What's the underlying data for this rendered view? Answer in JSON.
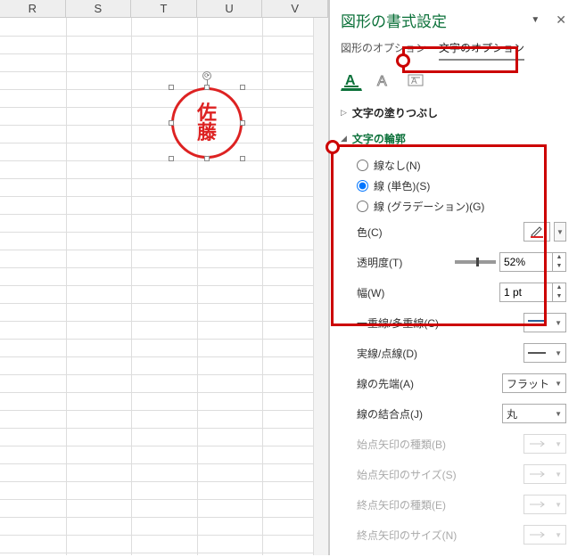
{
  "columns": [
    "R",
    "S",
    "T",
    "U",
    "V"
  ],
  "hanko_text_top": "佐",
  "hanko_text_bottom": "藤",
  "pane_title": "図形の書式設定",
  "tab_shape": "図形のオプション",
  "tab_text": "文字のオプション",
  "sec_fill": "文字の塗りつぶし",
  "sec_outline": "文字の輪郭",
  "radio_none": "線なし(N)",
  "radio_solid": "線 (単色)(S)",
  "radio_grad": "線 (グラデーション)(G)",
  "lab_color": "色(C)",
  "lab_trans": "透明度(T)",
  "val_trans": "52%",
  "lab_width": "幅(W)",
  "val_width": "1 pt",
  "lab_compound": "一重線/多重線(C)",
  "lab_dash": "実線/点線(D)",
  "lab_cap": "線の先端(A)",
  "val_cap": "フラット",
  "lab_join": "線の結合点(J)",
  "val_join": "丸",
  "lab_begin_type": "始点矢印の種類(B)",
  "lab_begin_size": "始点矢印のサイズ(S)",
  "lab_end_type": "終点矢印の種類(E)",
  "lab_end_size": "終点矢印のサイズ(N)"
}
